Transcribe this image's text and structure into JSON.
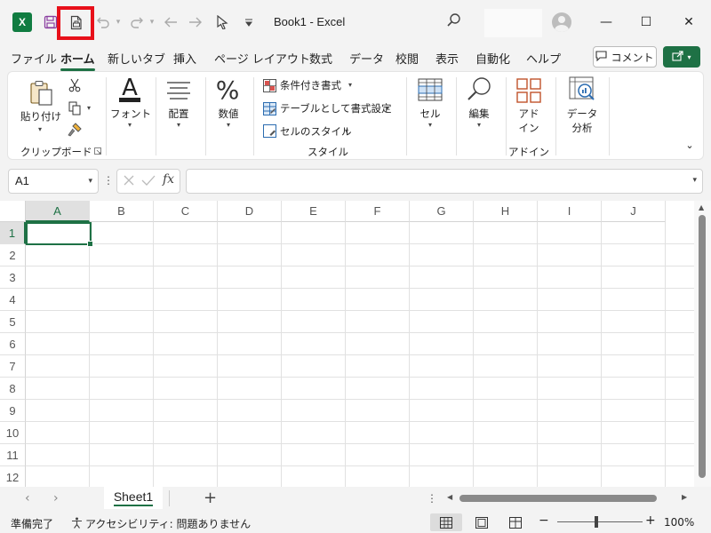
{
  "titlebar": {
    "app_icon_letter": "X",
    "title": "Book1  -  Excel",
    "minimize": "—",
    "maximize": "☐",
    "close": "✕"
  },
  "tabs": [
    "ファイル",
    "ホーム",
    "新しいタブ",
    "挿入",
    "ページ レイアウト",
    "数式",
    "データ",
    "校閲",
    "表示",
    "自動化",
    "ヘルプ"
  ],
  "active_tab": "ホーム",
  "comment_button": "コメント",
  "ribbon": {
    "clipboard": {
      "paste": "貼り付け",
      "group_label": "クリップボード"
    },
    "font": {
      "label": "フォント",
      "glyph": "A"
    },
    "alignment": {
      "label": "配置"
    },
    "number": {
      "label": "数値",
      "glyph": "%"
    },
    "styles": {
      "conditional": "条件付き書式",
      "table": "テーブルとして書式設定",
      "cell_styles": "セルのスタイル",
      "group_label": "スタイル"
    },
    "cells": {
      "label": "セル"
    },
    "editing": {
      "label": "編集"
    },
    "addins": {
      "label_line1": "アド",
      "label_line2": "イン",
      "group_label": "アドイン"
    },
    "analysis": {
      "label_line1": "データ",
      "label_line2": "分析"
    }
  },
  "formula_bar": {
    "name_box": "A1",
    "fx": "fx",
    "value": ""
  },
  "grid": {
    "columns": [
      "A",
      "B",
      "C",
      "D",
      "E",
      "F",
      "G",
      "H",
      "I",
      "J"
    ],
    "rows": [
      "1",
      "2",
      "3",
      "4",
      "5",
      "6",
      "7",
      "8",
      "9",
      "10",
      "11",
      "12"
    ],
    "selected_cell": "A1"
  },
  "sheets": [
    "Sheet1"
  ],
  "status": {
    "ready": "準備完了",
    "accessibility": "アクセシビリティ: 問題ありません",
    "zoom": "100%"
  },
  "colors": {
    "excel_green": "#1e7145",
    "highlight_red": "#e8101a"
  }
}
